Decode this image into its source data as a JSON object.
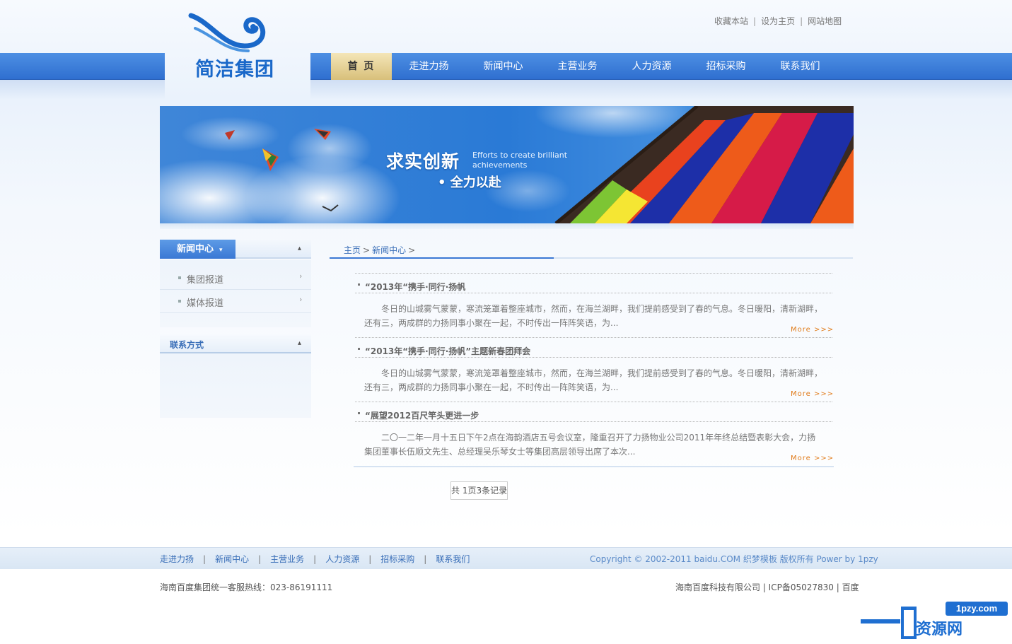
{
  "toplinks": [
    {
      "label": "收藏本站"
    },
    {
      "label": "设为主页"
    },
    {
      "label": "网站地图"
    }
  ],
  "logo": {
    "text": "简洁集团"
  },
  "nav": [
    {
      "label": "首 页"
    },
    {
      "label": "走进力扬"
    },
    {
      "label": "新闻中心"
    },
    {
      "label": "主营业务"
    },
    {
      "label": "人力资源"
    },
    {
      "label": "招标采购"
    },
    {
      "label": "联系我们"
    }
  ],
  "banner": {
    "slogan_main": "求实创新",
    "slogan_en": "Efforts to create brilliant achievements",
    "slogan_sub": "• 全力以赴"
  },
  "sidebar": {
    "title": "新闻中心",
    "caret": "▾",
    "collapse": "▴",
    "items": [
      {
        "label": "集团报道",
        "arrow": "›"
      },
      {
        "label": "媒体报道",
        "arrow": "›"
      }
    ],
    "contact_title": "联系方式"
  },
  "breadcrumb": {
    "home": "主页",
    "section": "新闻中心",
    "sep": ">"
  },
  "articles": [
    {
      "title": "“2013年“携手·同行·扬帆",
      "summary": "冬日的山城雾气蒙蒙，寒流笼罩着整座城市，然而，在海兰湖畔，我们提前感受到了春的气息。冬日暖阳，清新湖畔，还有三，两成群的力扬同事小聚在一起，不时传出一阵阵笑语，为...",
      "more": "More >>>"
    },
    {
      "title": "“2013年“携手·同行·扬帆”主题新春团拜会",
      "summary": "冬日的山城雾气蒙蒙，寒流笼罩着整座城市，然而，在海兰湖畔，我们提前感受到了春的气息。冬日暖阳，清新湖畔，还有三，两成群的力扬同事小聚在一起，不时传出一阵阵笑语，为...",
      "more": "More >>>"
    },
    {
      "title": "“展望2012百尺竿头更进一步",
      "summary": "二〇一二年一月十五日下午2点在海韵酒店五号会议室，隆重召开了力扬物业公司2011年年终总结暨表彰大会，力扬集团董事长伍顺文先生、总经理吴乐琴女士等集团高层领导出席了本次...",
      "more": "More >>>"
    }
  ],
  "pager": {
    "text": "共 1页3条记录"
  },
  "footer": {
    "links": [
      {
        "label": "走进力扬"
      },
      {
        "label": "新闻中心"
      },
      {
        "label": "主营业务"
      },
      {
        "label": "人力资源"
      },
      {
        "label": "招标采购"
      },
      {
        "label": "联系我们"
      }
    ],
    "sep": "|",
    "copyright": "Copyright © 2002-2011 baidu.COM 织梦模板 版权所有 Power by 1pzy",
    "hotline": "海南百度集团统一客服热线：023-86191111",
    "company": "海南百度科技有限公司 | ICP备05027830 | 百度"
  },
  "watermark": {
    "domain": "1pzy.com",
    "name": "资源网"
  },
  "colors": {
    "nav_blue": "#3a78d4",
    "active_gold": "#e3d08f",
    "link_blue": "#3a6fb8",
    "more_orange": "#e07b1a"
  }
}
